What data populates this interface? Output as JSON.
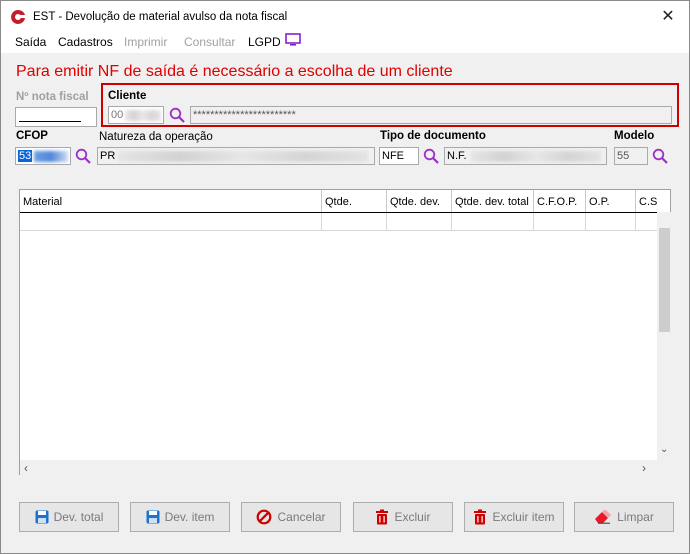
{
  "window": {
    "title": "EST - Devolução de material avulso da nota fiscal",
    "close_symbol": "✕",
    "app_icon": "app-logo-icon"
  },
  "menu": {
    "items": [
      {
        "label": "Saída",
        "enabled": true
      },
      {
        "label": "Cadastros",
        "enabled": true
      },
      {
        "label": "Imprimir",
        "enabled": false
      },
      {
        "label": "Consultar",
        "enabled": false
      },
      {
        "label": "LGPD",
        "enabled": true
      }
    ],
    "lgpd_icon": "monitor-icon"
  },
  "warning": {
    "text": "Para emitir NF de saída é necessário a escolha de um cliente",
    "color": "#e00000"
  },
  "form": {
    "nota_fiscal_label": "Nº nota fiscal",
    "nota_fiscal_value": "",
    "cliente_label": "Cliente",
    "cliente_code": "00",
    "cliente_name": "************************",
    "cfop_label": "CFOP",
    "cfop_value": "53",
    "natureza_label": "Natureza da operação",
    "natureza_value": "PR",
    "tipo_doc_label": "Tipo de documento",
    "tipo_doc_code": "NFE",
    "tipo_doc_desc": "N.F.",
    "modelo_label": "Modelo",
    "modelo_value": "55"
  },
  "table": {
    "columns": [
      "Material",
      "Qtde.",
      "Qtde. dev.",
      "Qtde. dev. total",
      "C.F.O.P.",
      "O.P.",
      "C.S"
    ],
    "rows": []
  },
  "buttons": {
    "dev_total": "Dev. total",
    "dev_item": "Dev. item",
    "cancelar": "Cancelar",
    "excluir": "Excluir",
    "excluir_item": "Excluir item",
    "limpar": "Limpar"
  },
  "colors": {
    "accent_red": "#d00000",
    "magnifier_purple": "#9b30c8",
    "save_blue": "#1e73d2"
  }
}
